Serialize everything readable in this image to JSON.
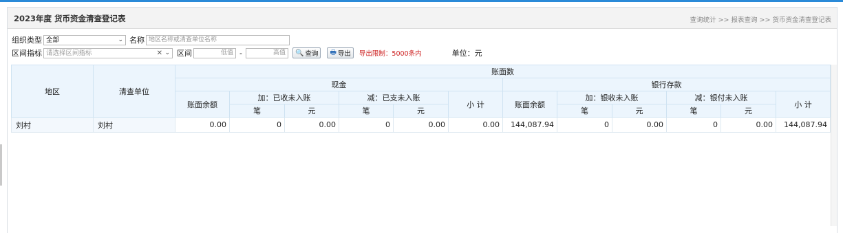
{
  "page": {
    "title": "2023年度 货币资金清查登记表",
    "breadcrumb": "查询统计 >> 报表查询 >> 货币资金清查登记表"
  },
  "filters": {
    "org_type_label": "组织类型",
    "org_type_value": "全部",
    "name_label": "名称",
    "name_placeholder": "地区名称或清查单位名称",
    "indicator_label": "区间指标",
    "indicator_placeholder": "请选择区间指标",
    "range_label": "区间",
    "range_low_placeholder": "低值",
    "range_sep": "-",
    "range_high_placeholder": "高值",
    "query_button": "查询",
    "export_button": "导出",
    "export_limit": "导出限制：5000条内",
    "unit_label": "单位：元"
  },
  "table": {
    "h_region": "地区",
    "h_unit": "清查单位",
    "h_book": "账面数",
    "h_cash": "现金",
    "h_bank": "银行存款",
    "h_balance": "账面余额",
    "h_cash_add": "加：已收未入账",
    "h_cash_sub": "减：已支未入账",
    "h_bank_add": "加：银收未入账",
    "h_bank_sub": "减：银付未入账",
    "h_subtotal": "小 计",
    "h_count": "笔",
    "h_yuan": "元",
    "rows": [
      {
        "region": "刘村",
        "unit": "刘村",
        "cash_balance": "0.00",
        "cash_add_count": "0",
        "cash_add_amount": "0.00",
        "cash_sub_count": "0",
        "cash_sub_amount": "0.00",
        "cash_subtotal": "0.00",
        "bank_balance": "144,087.94",
        "bank_add_count": "0",
        "bank_add_amount": "0.00",
        "bank_sub_count": "0",
        "bank_sub_amount": "0.00",
        "bank_subtotal": "144,087.94"
      }
    ]
  },
  "icons": {
    "query": "magnifier-icon",
    "export": "printer-icon",
    "select": "chevron-down-icon",
    "clear": "clear-icon"
  }
}
